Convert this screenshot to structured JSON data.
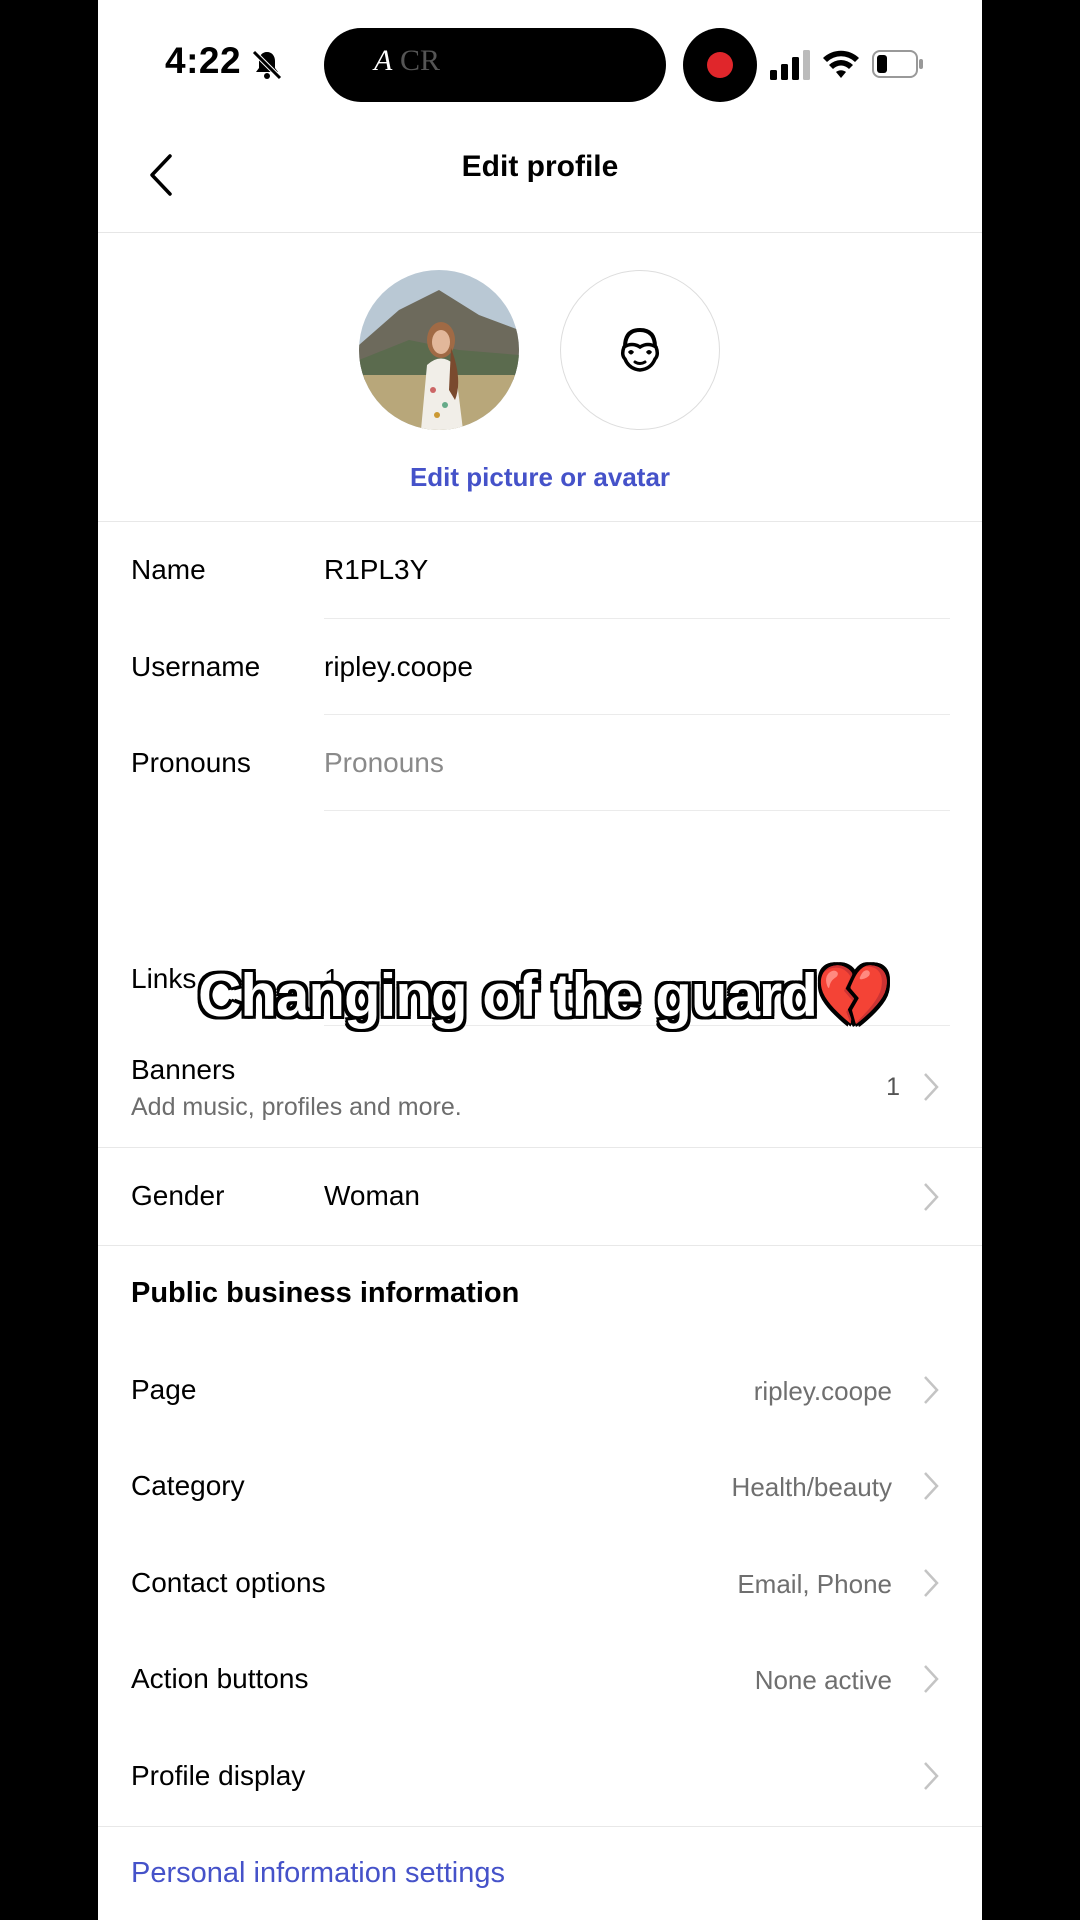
{
  "status_bar": {
    "time": "4:22",
    "island_left_icon": "A",
    "island_right_icon": "CR"
  },
  "header": {
    "title": "Edit profile"
  },
  "avatar": {
    "edit_label": "Edit picture or avatar"
  },
  "fields": {
    "name": {
      "label": "Name",
      "value": "R1PL3Y"
    },
    "username": {
      "label": "Username",
      "value": "ripley.coope"
    },
    "pronouns": {
      "label": "Pronouns",
      "placeholder": "Pronouns"
    },
    "links": {
      "label": "Links",
      "value": "1"
    }
  },
  "banners": {
    "label": "Banners",
    "subtitle": "Add music, profiles and more.",
    "count": "1"
  },
  "gender": {
    "label": "Gender",
    "value": "Woman"
  },
  "business": {
    "title": "Public business information",
    "rows": [
      {
        "label": "Page",
        "value": "ripley.coope"
      },
      {
        "label": "Category",
        "value": "Health/beauty"
      },
      {
        "label": "Contact options",
        "value": "Email, Phone"
      },
      {
        "label": "Action buttons",
        "value": "None active"
      },
      {
        "label": "Profile display",
        "value": ""
      }
    ]
  },
  "personal_info_link": "Personal information settings",
  "caption": "Changing of the guard💔",
  "colors": {
    "accent": "#4552c9",
    "record": "#e0262b"
  }
}
